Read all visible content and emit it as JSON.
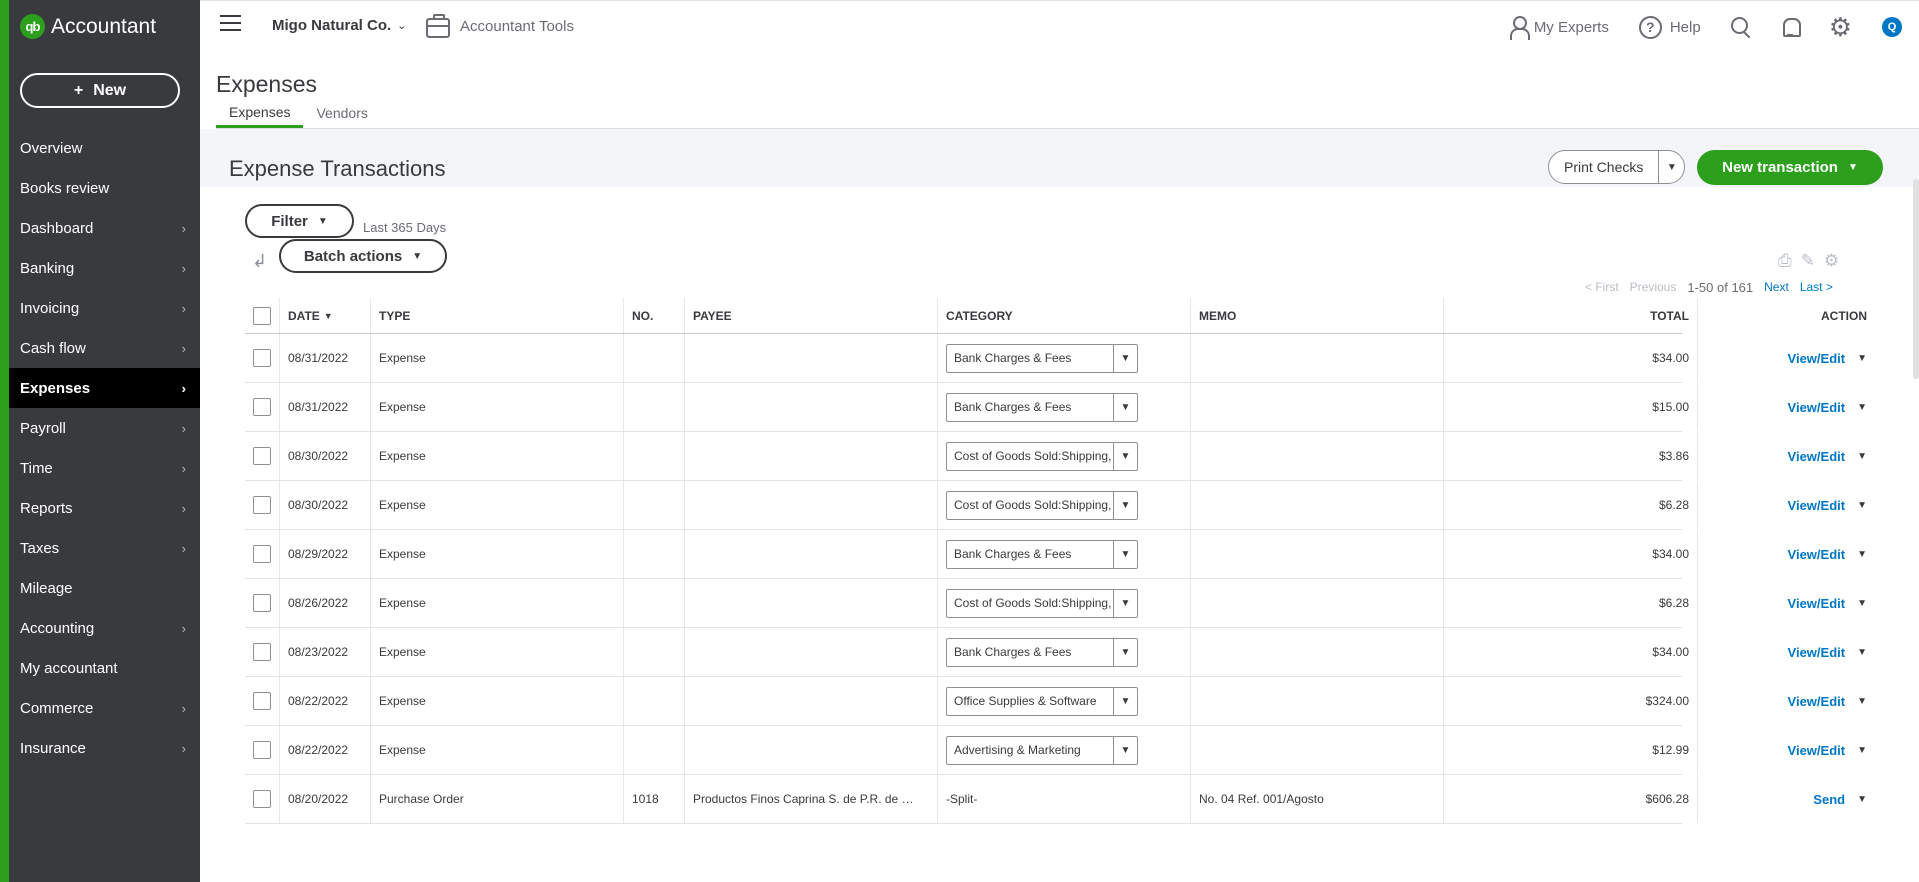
{
  "app": {
    "brand": "Accountant",
    "logo_text": "qb",
    "new_button": "New",
    "new_plus": "+"
  },
  "sidebar": {
    "items": [
      {
        "label": "Overview",
        "chevron": false,
        "active": false
      },
      {
        "label": "Books review",
        "chevron": false,
        "active": false
      },
      {
        "label": "Dashboard",
        "chevron": true,
        "active": false
      },
      {
        "label": "Banking",
        "chevron": true,
        "active": false
      },
      {
        "label": "Invoicing",
        "chevron": true,
        "active": false
      },
      {
        "label": "Cash flow",
        "chevron": true,
        "active": false
      },
      {
        "label": "Expenses",
        "chevron": true,
        "active": true
      },
      {
        "label": "Payroll",
        "chevron": true,
        "active": false
      },
      {
        "label": "Time",
        "chevron": true,
        "active": false
      },
      {
        "label": "Reports",
        "chevron": true,
        "active": false
      },
      {
        "label": "Taxes",
        "chevron": true,
        "active": false
      },
      {
        "label": "Mileage",
        "chevron": false,
        "active": false
      },
      {
        "label": "Accounting",
        "chevron": true,
        "active": false
      },
      {
        "label": "My accountant",
        "chevron": false,
        "active": false
      },
      {
        "label": "Commerce",
        "chevron": true,
        "active": false
      },
      {
        "label": "Insurance",
        "chevron": true,
        "active": false
      }
    ]
  },
  "topbar": {
    "company": "Migo Natural Co.",
    "accountant_tools": "Accountant Tools",
    "my_experts": "My Experts",
    "help": "Help",
    "help_glyph": "?",
    "avatar_initial": "Q"
  },
  "page": {
    "title": "Expenses",
    "tabs": [
      {
        "label": "Expenses",
        "active": true
      },
      {
        "label": "Vendors",
        "active": false
      }
    ],
    "section_title": "Expense Transactions",
    "print_checks": "Print Checks",
    "new_transaction": "New transaction",
    "filter": "Filter",
    "filter_range": "Last 365 Days",
    "batch_actions": "Batch actions"
  },
  "pager": {
    "first": "< First",
    "previous": "Previous",
    "range": "1-50 of 161",
    "next": "Next",
    "last": "Last >"
  },
  "table": {
    "headers": {
      "date": "DATE",
      "type": "TYPE",
      "no": "NO.",
      "payee": "PAYEE",
      "category": "CATEGORY",
      "memo": "MEMO",
      "total": "TOTAL",
      "action": "ACTION"
    },
    "rows": [
      {
        "date": "08/31/2022",
        "type": "Expense",
        "no": "",
        "payee": "",
        "category": "Bank Charges & Fees",
        "memo": "",
        "total": "$34.00",
        "action": "View/Edit",
        "select": true
      },
      {
        "date": "08/31/2022",
        "type": "Expense",
        "no": "",
        "payee": "",
        "category": "Bank Charges & Fees",
        "memo": "",
        "total": "$15.00",
        "action": "View/Edit",
        "select": true
      },
      {
        "date": "08/30/2022",
        "type": "Expense",
        "no": "",
        "payee": "",
        "category": "Cost of Goods Sold:Shipping, fr",
        "memo": "",
        "total": "$3.86",
        "action": "View/Edit",
        "select": true
      },
      {
        "date": "08/30/2022",
        "type": "Expense",
        "no": "",
        "payee": "",
        "category": "Cost of Goods Sold:Shipping, fr",
        "memo": "",
        "total": "$6.28",
        "action": "View/Edit",
        "select": true
      },
      {
        "date": "08/29/2022",
        "type": "Expense",
        "no": "",
        "payee": "",
        "category": "Bank Charges & Fees",
        "memo": "",
        "total": "$34.00",
        "action": "View/Edit",
        "select": true
      },
      {
        "date": "08/26/2022",
        "type": "Expense",
        "no": "",
        "payee": "",
        "category": "Cost of Goods Sold:Shipping, fr",
        "memo": "",
        "total": "$6.28",
        "action": "View/Edit",
        "select": true
      },
      {
        "date": "08/23/2022",
        "type": "Expense",
        "no": "",
        "payee": "",
        "category": "Bank Charges & Fees",
        "memo": "",
        "total": "$34.00",
        "action": "View/Edit",
        "select": true
      },
      {
        "date": "08/22/2022",
        "type": "Expense",
        "no": "",
        "payee": "",
        "category": "Office Supplies & Software",
        "memo": "",
        "total": "$324.00",
        "action": "View/Edit",
        "select": true
      },
      {
        "date": "08/22/2022",
        "type": "Expense",
        "no": "",
        "payee": "",
        "category": "Advertising & Marketing",
        "memo": "",
        "total": "$12.99",
        "action": "View/Edit",
        "select": true
      },
      {
        "date": "08/20/2022",
        "type": "Purchase Order",
        "no": "1018",
        "payee": "Productos Finos Caprina S. de P.R. de …",
        "category": "-Split-",
        "memo": "No. 04 Ref. 001/Agosto",
        "total": "$606.28",
        "action": "Send",
        "select": false
      }
    ]
  },
  "colors": {
    "brand_green": "#2ca01c",
    "sidebar_bg": "#393a3d",
    "link_blue": "#0077c5"
  }
}
